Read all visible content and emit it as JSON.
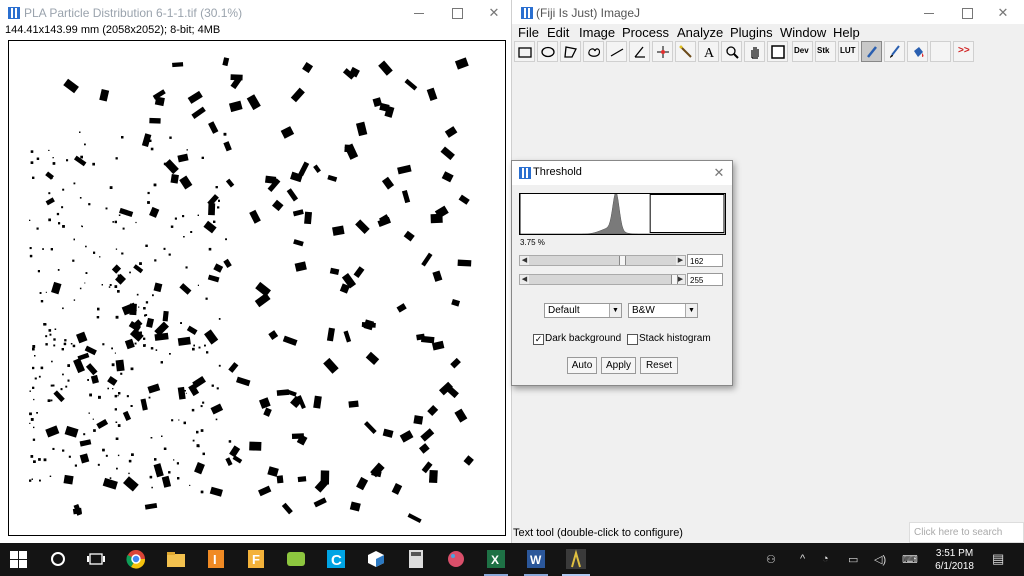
{
  "image_window": {
    "title": "PLA Particle Distribution 6-1-1.tif (30.1%)",
    "info": "144.41x143.99 mm (2058x2052); 8-bit; 4MB"
  },
  "main_window": {
    "title": "(Fiji Is Just) ImageJ",
    "menus": [
      "File",
      "Edit",
      "Image",
      "Process",
      "Analyze",
      "Plugins",
      "Window",
      "Help"
    ],
    "tools": {
      "dev_label": "Dev",
      "stk_label": "Stk",
      "lut_label": "LUT",
      "more_label": ">>"
    },
    "status": "Text tool (double-click to configure)"
  },
  "threshold": {
    "title": "Threshold",
    "percent": "3.75 %",
    "min_value": "162",
    "max_value": "255",
    "min_fraction": 0.635,
    "max_fraction": 1.0,
    "method": "Default",
    "mode": "B&W",
    "dark_background_label": "Dark background",
    "dark_background_checked": true,
    "stack_histogram_label": "Stack histogram",
    "stack_histogram_checked": false,
    "auto_label": "Auto",
    "apply_label": "Apply",
    "reset_label": "Reset"
  },
  "search": {
    "placeholder": "Click here to search"
  },
  "taskbar": {
    "time": "3:51 PM",
    "date": "6/1/2018"
  }
}
